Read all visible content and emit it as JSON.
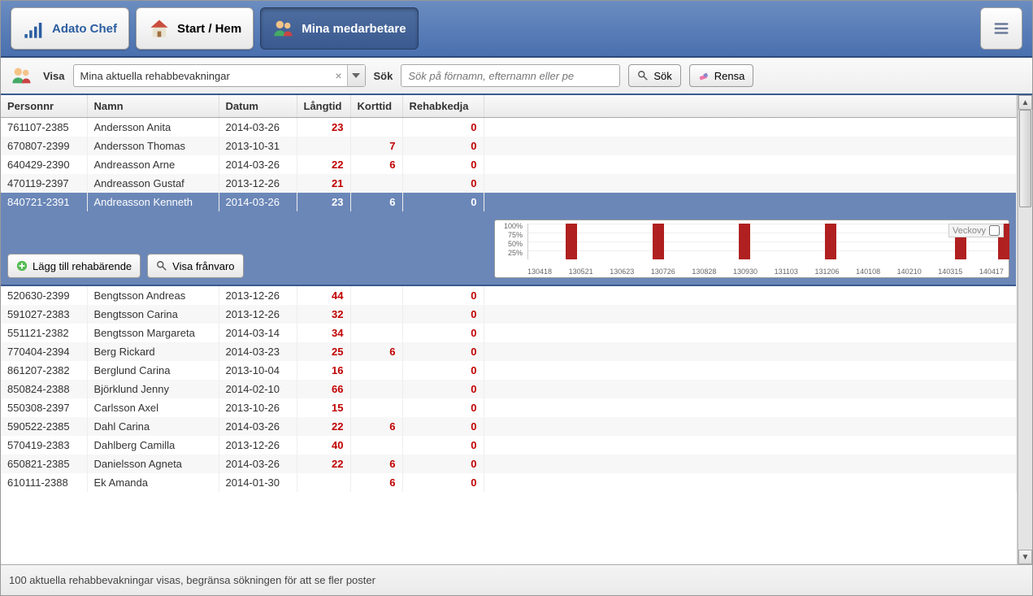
{
  "nav": {
    "brand": "Adato Chef",
    "home": "Start / Hem",
    "employees": "Mina medarbetare"
  },
  "controls": {
    "visa_label": "Visa",
    "visa_value": "Mina aktuella rehabbevakningar",
    "sok_label": "Sök",
    "sok_placeholder": "Sök på förnamn, efternamn eller pe",
    "sok_btn": "Sök",
    "rensa_btn": "Rensa"
  },
  "columns": {
    "personnr": "Personnr",
    "namn": "Namn",
    "datum": "Datum",
    "langtid": "Långtid",
    "korttid": "Korttid",
    "rehabkedja": "Rehabkedja"
  },
  "rows": [
    {
      "pnr": "761107-2385",
      "name": "Andersson Anita",
      "date": "2014-03-26",
      "lang": "23",
      "kort": "",
      "rehab": "0"
    },
    {
      "pnr": "670807-2399",
      "name": "Andersson Thomas",
      "date": "2013-10-31",
      "lang": "",
      "kort": "7",
      "rehab": "0"
    },
    {
      "pnr": "640429-2390",
      "name": "Andreasson Arne",
      "date": "2014-03-26",
      "lang": "22",
      "kort": "6",
      "rehab": "0"
    },
    {
      "pnr": "470119-2397",
      "name": "Andreasson Gustaf",
      "date": "2013-12-26",
      "lang": "21",
      "kort": "",
      "rehab": "0"
    },
    {
      "pnr": "840721-2391",
      "name": "Andreasson Kenneth",
      "date": "2014-03-26",
      "lang": "23",
      "kort": "6",
      "rehab": "0",
      "selected": true
    },
    {
      "pnr": "520630-2399",
      "name": "Bengtsson Andreas",
      "date": "2013-12-26",
      "lang": "44",
      "kort": "",
      "rehab": "0"
    },
    {
      "pnr": "591027-2383",
      "name": "Bengtsson Carina",
      "date": "2013-12-26",
      "lang": "32",
      "kort": "",
      "rehab": "0"
    },
    {
      "pnr": "551121-2382",
      "name": "Bengtsson Margareta",
      "date": "2014-03-14",
      "lang": "34",
      "kort": "",
      "rehab": "0"
    },
    {
      "pnr": "770404-2394",
      "name": "Berg Rickard",
      "date": "2014-03-23",
      "lang": "25",
      "kort": "6",
      "rehab": "0"
    },
    {
      "pnr": "861207-2382",
      "name": "Berglund Carina",
      "date": "2013-10-04",
      "lang": "16",
      "kort": "",
      "rehab": "0"
    },
    {
      "pnr": "850824-2388",
      "name": "Björklund Jenny",
      "date": "2014-02-10",
      "lang": "66",
      "kort": "",
      "rehab": "0"
    },
    {
      "pnr": "550308-2397",
      "name": "Carlsson Axel",
      "date": "2013-10-26",
      "lang": "15",
      "kort": "",
      "rehab": "0"
    },
    {
      "pnr": "590522-2385",
      "name": "Dahl Carina",
      "date": "2014-03-26",
      "lang": "22",
      "kort": "6",
      "rehab": "0"
    },
    {
      "pnr": "570419-2383",
      "name": "Dahlberg Camilla",
      "date": "2013-12-26",
      "lang": "40",
      "kort": "",
      "rehab": "0"
    },
    {
      "pnr": "650821-2385",
      "name": "Danielsson Agneta",
      "date": "2014-03-26",
      "lang": "22",
      "kort": "6",
      "rehab": "0"
    },
    {
      "pnr": "610111-2388",
      "name": "Ek Amanda",
      "date": "2014-01-30",
      "lang": "",
      "kort": "6",
      "rehab": "0"
    }
  ],
  "expand": {
    "add_btn": "Lägg till rehabärende",
    "view_btn": "Visa frånvaro",
    "veckovy": "Veckovy"
  },
  "chart_data": {
    "type": "bar",
    "title": "",
    "ylabel": "",
    "ylim": [
      0,
      100
    ],
    "yticks": [
      "100%",
      "75%",
      "50%",
      "25%"
    ],
    "categories": [
      "130418",
      "130521",
      "130623",
      "130726",
      "130828",
      "130930",
      "131103",
      "131206",
      "140108",
      "140210",
      "140315",
      "140417"
    ],
    "values": [
      0,
      100,
      0,
      100,
      0,
      100,
      0,
      100,
      0,
      0,
      100,
      100
    ]
  },
  "footer": "100 aktuella rehabbevakningar visas, begränsa sökningen för att se fler poster"
}
